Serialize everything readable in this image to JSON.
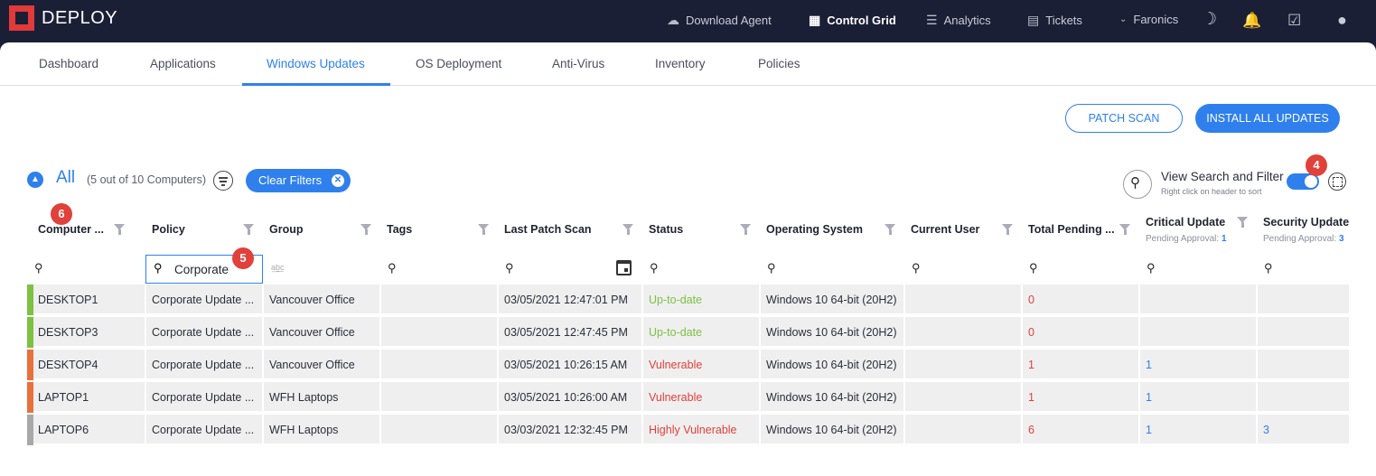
{
  "app": {
    "title": "DEPLOY"
  },
  "topnav": {
    "download_agent": "Download Agent",
    "control_grid": "Control Grid",
    "analytics": "Analytics",
    "tickets": "Tickets",
    "org": "Faronics"
  },
  "tabs": [
    "Dashboard",
    "Applications",
    "Windows Updates",
    "OS Deployment",
    "Anti-Virus",
    "Inventory",
    "Policies"
  ],
  "active_tab": "Windows Updates",
  "actions": {
    "patch_scan": "PATCH SCAN",
    "install_all": "INSTALL ALL UPDATES"
  },
  "group": {
    "label": "All",
    "count": "(5 out of 10 Computers)",
    "clear_filters": "Clear Filters"
  },
  "view_search": {
    "title": "View Search and Filter",
    "subtitle": "Right click on header to sort",
    "enabled": true
  },
  "badges": {
    "toggle": "4",
    "search": "5",
    "column": "6"
  },
  "columns": [
    {
      "label": "Computer ..."
    },
    {
      "label": "Policy"
    },
    {
      "label": "Group"
    },
    {
      "label": "Tags"
    },
    {
      "label": "Last Patch Scan"
    },
    {
      "label": "Status"
    },
    {
      "label": "Operating System"
    },
    {
      "label": "Current User"
    },
    {
      "label": "Total Pending ..."
    },
    {
      "label": "Critical Update",
      "sub": "Pending Approval:",
      "sub_value": "1"
    },
    {
      "label": "Security Update",
      "sub": "Pending Approval:",
      "sub_value": "3"
    }
  ],
  "policy_search_value": "Corporate",
  "rows": [
    {
      "computer": "DESKTOP1",
      "policy": "Corporate Update ...",
      "group": "Vancouver Office",
      "tags": "",
      "last_scan": "03/05/2021 12:47:01 PM",
      "status": "Up-to-date",
      "os": "Windows 10 64-bit (20H2)",
      "user": "",
      "total_pending": "0",
      "critical": "",
      "security": ""
    },
    {
      "computer": "DESKTOP3",
      "policy": "Corporate Update ...",
      "group": "Vancouver Office",
      "tags": "",
      "last_scan": "03/05/2021 12:47:45 PM",
      "status": "Up-to-date",
      "os": "Windows 10 64-bit (20H2)",
      "user": "",
      "total_pending": "0",
      "critical": "",
      "security": ""
    },
    {
      "computer": "DESKTOP4",
      "policy": "Corporate Update ...",
      "group": "Vancouver Office",
      "tags": "",
      "last_scan": "03/05/2021 10:26:15 AM",
      "status": "Vulnerable",
      "os": "Windows 10 64-bit (20H2)",
      "user": "",
      "total_pending": "1",
      "critical": "1",
      "security": ""
    },
    {
      "computer": "LAPTOP1",
      "policy": "Corporate Update ...",
      "group": "WFH Laptops",
      "tags": "",
      "last_scan": "03/05/2021 10:26:00 AM",
      "status": "Vulnerable",
      "os": "Windows 10 64-bit (20H2)",
      "user": "",
      "total_pending": "1",
      "critical": "1",
      "security": ""
    },
    {
      "computer": "LAPTOP6",
      "policy": "Corporate Update ...",
      "group": "WFH Laptops",
      "tags": "",
      "last_scan": "03/03/2021 12:32:45 PM",
      "status": "Highly Vulnerable",
      "os": "Windows 10 64-bit (20H2)",
      "user": "",
      "total_pending": "6",
      "critical": "1",
      "security": "3"
    }
  ],
  "colors": {
    "accent": "#2f80ed",
    "up_to_date": "#7cc142",
    "vulnerable": "#e8703a",
    "highly_vulnerable": "#a8a8a8",
    "status_good_text": "#7cc142",
    "status_bad_text": "#e0413a"
  }
}
